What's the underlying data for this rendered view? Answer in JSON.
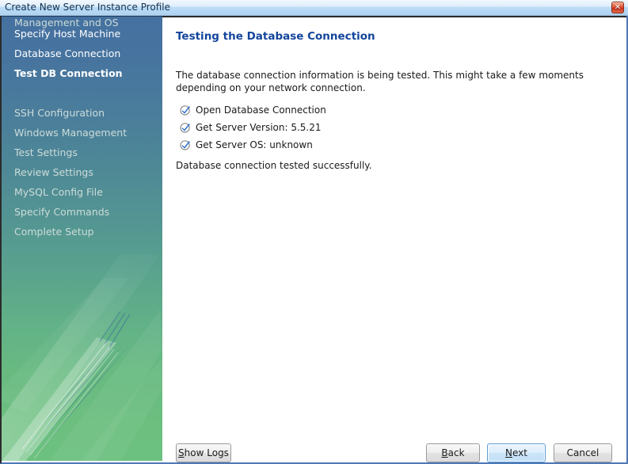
{
  "window": {
    "title": "Create New Server Instance Profile",
    "close_label": "✕",
    "close_icon": "close-icon"
  },
  "sidebar": {
    "items": [
      {
        "label": "Specify Host Machine",
        "state": "done"
      },
      {
        "label": "Database Connection",
        "state": "done"
      },
      {
        "label": "Test DB Connection",
        "state": "current"
      },
      {
        "label": "Management and OS",
        "state": "future"
      },
      {
        "label": "SSH Configuration",
        "state": "future"
      },
      {
        "label": "Windows Management",
        "state": "future"
      },
      {
        "label": "Test Settings",
        "state": "future"
      },
      {
        "label": "Review Settings",
        "state": "future"
      },
      {
        "label": "MySQL Config File",
        "state": "future"
      },
      {
        "label": "Specify Commands",
        "state": "future"
      },
      {
        "label": "Complete Setup",
        "state": "future"
      }
    ],
    "colors": {
      "gradient_top": "#4571a0",
      "gradient_bottom": "#6cbf7f",
      "text_active": "#ffffff",
      "text_inactive": "#cddcd8"
    }
  },
  "content": {
    "page_title": "Testing the Database Connection",
    "title_color": "#13459b",
    "description": "The database connection information is being tested. This might take a few moments depending on your network connection.",
    "tasks": [
      {
        "icon": "check-circle-icon",
        "label": "Open Database Connection",
        "checked": true
      },
      {
        "icon": "check-circle-icon",
        "label": "Get Server Version: 5.5.21",
        "checked": true
      },
      {
        "icon": "check-circle-icon",
        "label": "Get Server OS: unknown",
        "checked": true
      }
    ],
    "result_message": "Database connection tested successfully."
  },
  "footer": {
    "show_logs": {
      "prefix": "",
      "mnemonic": "S",
      "suffix": "how Logs"
    },
    "back": {
      "prefix": "",
      "mnemonic": "B",
      "suffix": "ack"
    },
    "next": {
      "prefix": "",
      "mnemonic": "N",
      "suffix": "ext"
    },
    "cancel": {
      "prefix": "Cancel",
      "mnemonic": "",
      "suffix": ""
    }
  }
}
